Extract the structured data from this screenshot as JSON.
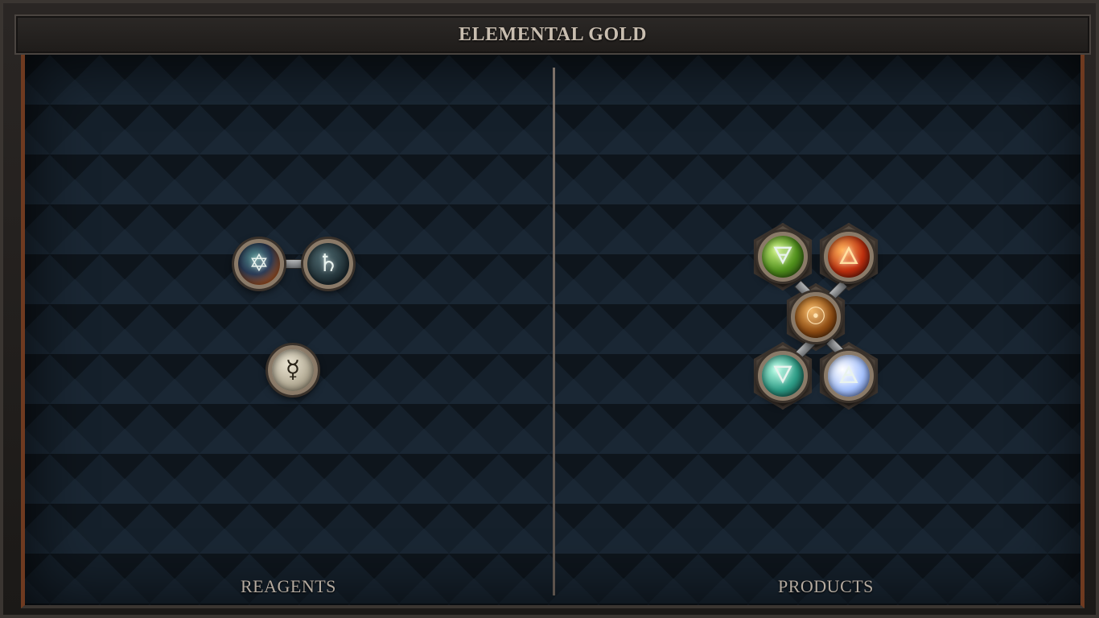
{
  "header": {
    "title": "ELEMENTAL GOLD"
  },
  "reagents": {
    "label": "REAGENTS",
    "items": [
      {
        "name": "star-hexagram-orb",
        "symbol": "✡"
      },
      {
        "name": "saturn-orb",
        "symbol": "♄"
      },
      {
        "name": "mercury-orb",
        "symbol": "☿"
      }
    ]
  },
  "products": {
    "label": "PRODUCTS",
    "items": [
      {
        "name": "earth-orb",
        "symbol": "🜃"
      },
      {
        "name": "fire-orb",
        "symbol": "🜂"
      },
      {
        "name": "gold-orb",
        "symbol": "☉"
      },
      {
        "name": "water-orb",
        "symbol": "🜄"
      },
      {
        "name": "air-orb",
        "symbol": "🜁"
      }
    ]
  },
  "colors": {
    "border_accent": "#6e3a20",
    "board_bg": "#15202b",
    "title_text": "#c9beb0"
  }
}
